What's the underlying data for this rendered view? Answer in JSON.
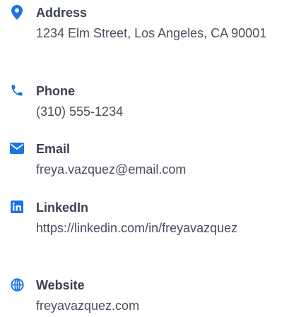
{
  "accent_color": "#1a73e8",
  "contacts": [
    {
      "icon": "map-pin-icon",
      "label": "Address",
      "value": "1234 Elm Street, Los Angeles, CA 90001"
    },
    {
      "icon": "phone-icon",
      "label": "Phone",
      "value": "(310) 555-1234"
    },
    {
      "icon": "envelope-icon",
      "label": "Email",
      "value": "freya.vazquez@email.com"
    },
    {
      "icon": "linkedin-icon",
      "label": "LinkedIn",
      "value": "https://linkedin.com/in/freyavazquez"
    },
    {
      "icon": "globe-icon",
      "label": "Website",
      "value": "freyavazquez.com"
    }
  ]
}
